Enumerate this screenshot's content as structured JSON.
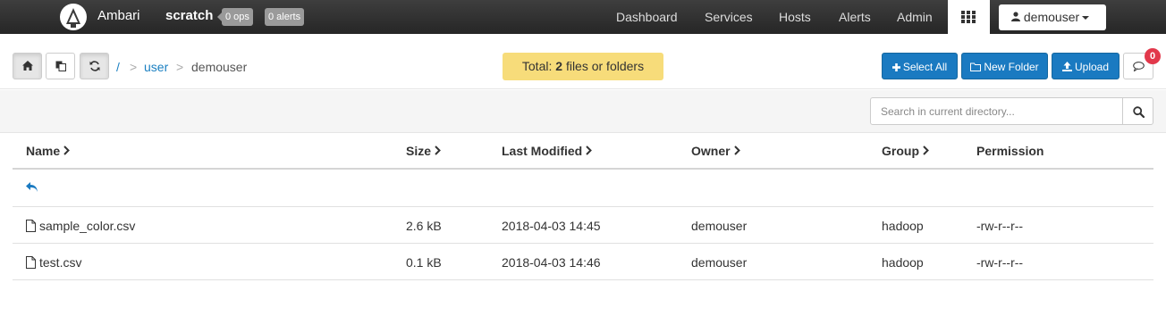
{
  "header": {
    "brand": "Ambari",
    "cluster": "scratch",
    "ops_badge": "0 ops",
    "alerts_badge": "0 alerts",
    "nav": [
      "Dashboard",
      "Services",
      "Hosts",
      "Alerts",
      "Admin"
    ],
    "user": "demouser"
  },
  "toolbar": {
    "breadcrumb": {
      "root": "/",
      "sep": ">",
      "user": "user",
      "current": "demouser"
    },
    "total": {
      "prefix": "Total:",
      "count": "2",
      "suffix": "files or folders"
    },
    "select_all": "Select All",
    "new_folder": "New Folder",
    "upload": "Upload",
    "notifications": "0"
  },
  "search": {
    "placeholder": "Search in current directory..."
  },
  "table": {
    "columns": [
      "Name",
      "Size",
      "Last Modified",
      "Owner",
      "Group",
      "Permission"
    ],
    "rows": [
      {
        "name": "sample_color.csv",
        "size": "2.6 kB",
        "modified": "2018-04-03 14:45",
        "owner": "demouser",
        "group": "hadoop",
        "permission": "-rw-r--r--"
      },
      {
        "name": "test.csv",
        "size": "0.1 kB",
        "modified": "2018-04-03 14:46",
        "owner": "demouser",
        "group": "hadoop",
        "permission": "-rw-r--r--"
      }
    ]
  },
  "colors": {
    "primary": "#1a7ac1",
    "link": "#1a7fc1",
    "total_bg": "#f7dc7a",
    "badge_red": "#e2384b",
    "nav_bg": "#2e2e2e"
  },
  "icons": [
    "ambari-logo-icon",
    "apps-grid-icon",
    "user-icon",
    "home-icon",
    "copy-icon",
    "refresh-icon",
    "plus-icon",
    "folder-icon",
    "upload-icon",
    "comment-icon",
    "search-icon",
    "chevron-right-icon",
    "reply-icon",
    "file-icon"
  ]
}
